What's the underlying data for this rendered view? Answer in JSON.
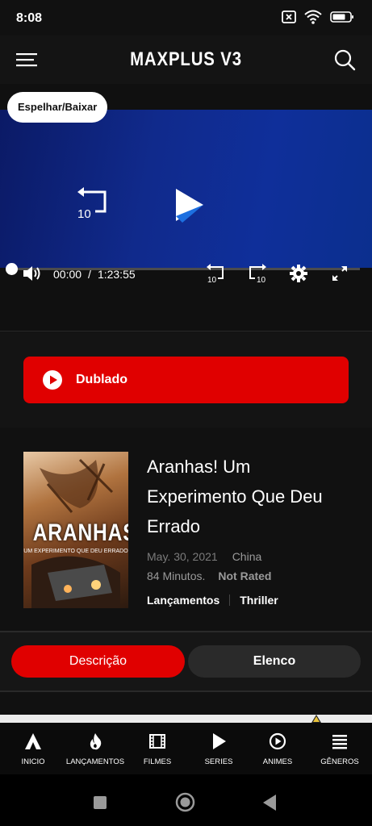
{
  "status_bar": {
    "time": "8:08",
    "icons": [
      "sim-off-icon",
      "wifi-icon",
      "battery-icon"
    ]
  },
  "header": {
    "title": "MAXPLUS V3",
    "menu_icon": "hamburger-menu-icon",
    "search_icon": "search-icon"
  },
  "player": {
    "mirror_label": "Espelhar/Baixar",
    "rewind_seconds": "10",
    "forward_seconds": "10",
    "current_time": "00:00",
    "separator": "/",
    "duration": "1:23:55",
    "progress": 0.0,
    "colors": {
      "video_bg": "#102a8c"
    }
  },
  "dub": {
    "label": "Dublado",
    "color": "#e00000"
  },
  "movie": {
    "poster_title": "ARANHAS!",
    "poster_subtitle": "UM EXPERIMENTO QUE DEU ERRADO",
    "title": "Aranhas! Um Experimento Que Deu Errado",
    "date": "May. 30, 2021",
    "country": "China",
    "duration": "84 Minutos.",
    "rating": "Not Rated",
    "genres": [
      "Lançamentos",
      "Thriller"
    ]
  },
  "tabs": {
    "description": "Descrição",
    "cast": "Elenco",
    "active": "description"
  },
  "bottom_nav": {
    "items": [
      {
        "label": "INICIO",
        "icon": "home-a-icon"
      },
      {
        "label": "LANÇAMENTOS",
        "icon": "flame-icon"
      },
      {
        "label": "FILMES",
        "icon": "film-icon"
      },
      {
        "label": "SERIES",
        "icon": "play-icon"
      },
      {
        "label": "ANIMES",
        "icon": "play-circle-icon"
      },
      {
        "label": "GÊNEROS",
        "icon": "list-icon"
      }
    ]
  },
  "system_nav": {
    "icons": [
      "recents-square-icon",
      "home-circle-icon",
      "back-triangle-icon"
    ]
  }
}
